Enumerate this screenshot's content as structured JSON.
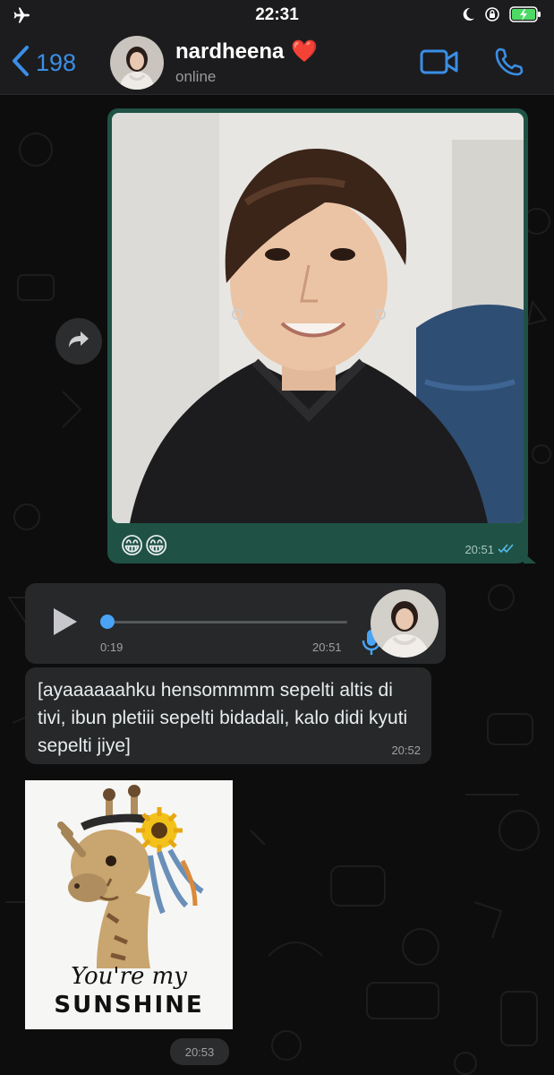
{
  "status_bar": {
    "time": "22:31",
    "icons": [
      "airplane-icon",
      "moon-icon",
      "orientation-lock-icon",
      "battery-charging-icon"
    ]
  },
  "header": {
    "back_count": "198",
    "contact_name": "nardheena",
    "name_emoji": "❤️",
    "status": "online",
    "icons": [
      "back-chevron-icon",
      "video-call-icon",
      "phone-icon"
    ]
  },
  "messages": {
    "outgoing_image": {
      "caption": "😁😁",
      "time": "20:51",
      "status_icon": "double-check-read-icon"
    },
    "voice": {
      "duration": "0:19",
      "time": "20:51",
      "progress": 0
    },
    "text": {
      "body": "[ayaaaaaahku hensommmm sepelti altis di tivi, ibun pletiii sepelti bidadali, kalo didi kyuti sepelti jiye]",
      "time": "20:52"
    },
    "sticker": {
      "line1": "You're my",
      "line2": "SUNSHINE",
      "time": "20:53"
    }
  },
  "colors": {
    "accent": "#3a8ee6",
    "outgoing_bubble": "#1f5244",
    "incoming_bubble": "#262829",
    "read_check": "#53bdeb"
  }
}
